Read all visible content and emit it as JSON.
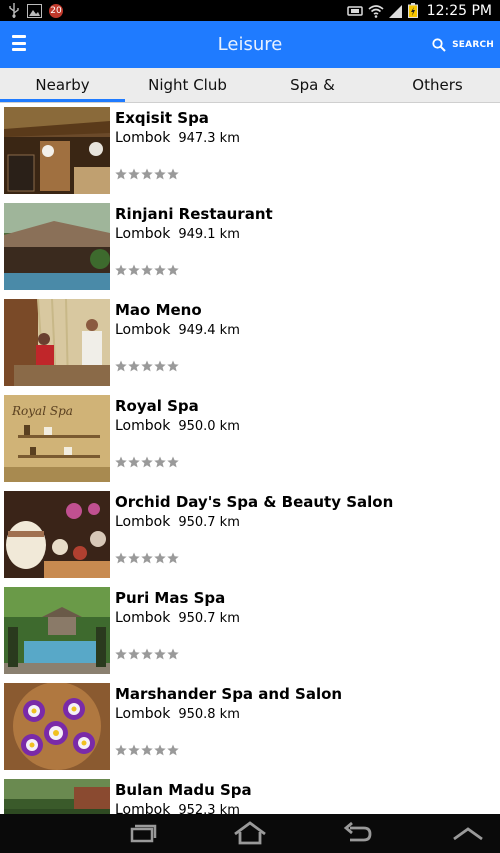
{
  "status_bar": {
    "time": "12:25 PM",
    "notification_count": "20",
    "icons": [
      "usb-icon",
      "image-icon",
      "notification-badge",
      "sync-icon",
      "wifi-icon",
      "signal-icon",
      "battery-icon"
    ]
  },
  "action_bar": {
    "title": "Leisure",
    "search_label": "SEARCH",
    "color": "#1f7bff"
  },
  "tabs": [
    {
      "label": "Nearby",
      "active": true
    },
    {
      "label": "Night Club",
      "active": false
    },
    {
      "label": "Spa &",
      "active": false
    },
    {
      "label": "Others",
      "active": false
    }
  ],
  "places": [
    {
      "name": "Exqisit Spa",
      "city": "Lombok",
      "distance": "947.3 km",
      "rating": 0
    },
    {
      "name": "Rinjani Restaurant",
      "city": "Lombok",
      "distance": "949.1 km",
      "rating": 0
    },
    {
      "name": "Mao Meno",
      "city": "Lombok",
      "distance": "949.4 km",
      "rating": 0
    },
    {
      "name": "Royal Spa",
      "city": "Lombok",
      "distance": "950.0 km",
      "rating": 0,
      "thumb_text": "Royal Spa"
    },
    {
      "name": "Orchid Day's Spa & Beauty Salon",
      "city": "Lombok",
      "distance": "950.7 km",
      "rating": 0
    },
    {
      "name": "Puri Mas Spa",
      "city": "Lombok",
      "distance": "950.7 km",
      "rating": 0
    },
    {
      "name": "Marshander Spa and Salon",
      "city": "Lombok",
      "distance": "950.8 km",
      "rating": 0
    },
    {
      "name": "Bulan Madu Spa",
      "city": "Lombok",
      "distance": "952.3 km",
      "rating": 0
    }
  ],
  "nav_bar": {
    "buttons": [
      "recent-apps-icon",
      "home-icon",
      "back-icon",
      "menu-up-icon"
    ]
  }
}
